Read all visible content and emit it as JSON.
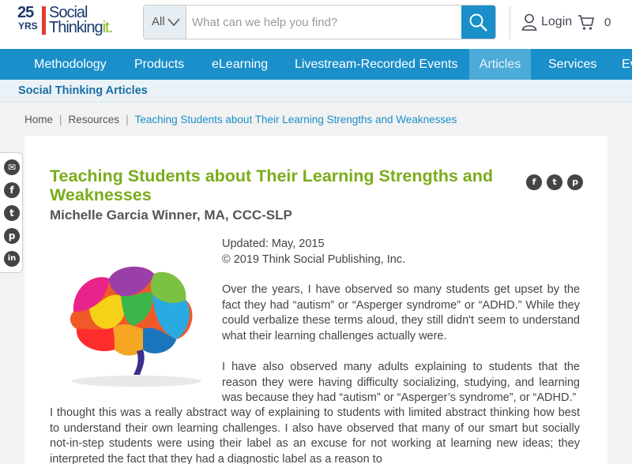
{
  "logo": {
    "number": "25",
    "years": "YRS",
    "brand_line1": "Social",
    "brand_line2_a": "Thinking",
    "brand_line2_b": "it."
  },
  "search": {
    "category": "All",
    "placeholder": "What can we help you find?"
  },
  "header": {
    "login": "Login",
    "cart_count": "0"
  },
  "nav": {
    "items": [
      "Methodology",
      "Products",
      "eLearning",
      "Livestream-Recorded Events",
      "Articles",
      "Services",
      "Ev"
    ],
    "active": "Articles"
  },
  "subbar": {
    "title": "Social Thinking Articles"
  },
  "breadcrumb": {
    "home": "Home",
    "resources": "Resources",
    "current": "Teaching Students about Their Learning Strengths and Weaknesses"
  },
  "article": {
    "title": "Teaching Students about Their Learning Strengths and Weaknesses",
    "author": "Michelle Garcia Winner, MA, CCC-SLP",
    "updated": "Updated: May, 2015",
    "copyright": "© 2019 Think Social Publishing, Inc.",
    "p1": "Over the years, I have observed so many students get upset by the fact they had “autism” or “Asperger syndrome” or “ADHD.” While they could verbalize these terms aloud, they still didn't seem to understand what their learning challenges actually were.",
    "p2": "I have also observed many adults explaining to students that the reason they were having difficulty socializing, studying, and learning was because they had “autism” or “Asperger’s syndrome”, or “ADHD.”",
    "p3": "I thought this was a really abstract way of explaining to students with limited abstract thinking how best to understand their own learning challenges. I also have observed that many of our smart but socially not-in-step students were using their label as an excuse for not working at learning new ideas; they interpreted the fact that they had a diagnostic label as a reason to"
  },
  "share_side": [
    "email-icon",
    "facebook-icon",
    "twitter-icon",
    "pinterest-icon",
    "linkedin-icon"
  ],
  "share_top": [
    "facebook-icon",
    "twitter-icon",
    "pinterest-icon"
  ],
  "colors": {
    "nav_blue": "#1a8fc9",
    "title_green": "#7aac1b",
    "nav_active": "#4dabd8"
  }
}
